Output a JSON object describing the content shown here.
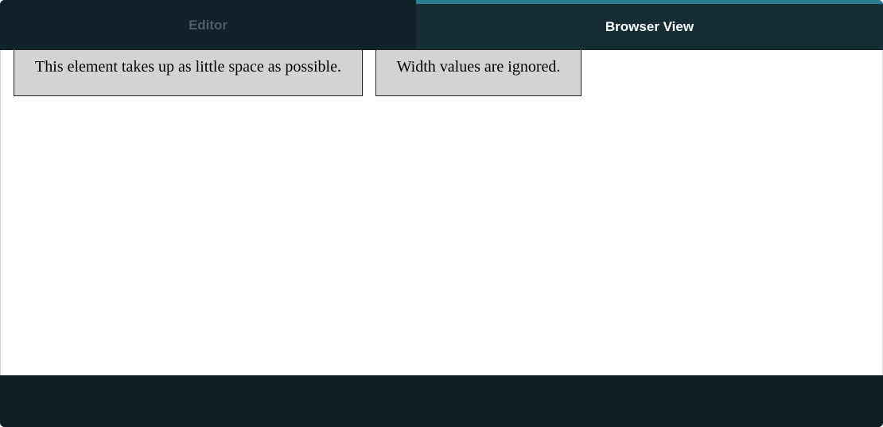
{
  "tabs": {
    "editor_label": "Editor",
    "browser_label": "Browser View",
    "active": "Browser View"
  },
  "preview": {
    "box_1_text": "This element takes up as little space as possible.",
    "box_2_text": "Width values are ignored."
  },
  "colors": {
    "tab_active_accent": "#2e7c92",
    "tab_bar_bg": "#10222a",
    "tab_active_bg": "#162d34",
    "inactive_tab_text": "#4a5d63",
    "demo_box_bg": "#d3d3d3",
    "footer_bg": "#101e23"
  }
}
